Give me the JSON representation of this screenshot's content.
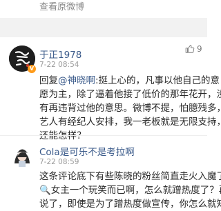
{
  "top": {
    "view_original": "查看原微博"
  },
  "comments": [
    {
      "name": "于正1978",
      "time": "7-22 08:54",
      "likes": "9",
      "avatar_text": "于正",
      "reply_prefix": "回复",
      "mention": "@神晓啊",
      "lines": [
        ":挺上心的，凡事以他自己的意",
        "愿为主，除了逼着他接了低价的那年花开，没",
        "有再违背过他的意思。微博不提，怕臆残多，",
        "艺人有经纪人安排，我一老板就是无限支持，",
        "还能怎样？"
      ]
    },
    {
      "name": "Cola是可乐不是考拉啊",
      "time": "7-22 08:59",
      "lines": [
        "这条评论底下有些陈晓的粉丝简直走火入魔了",
        "🔍女主一个玩笑而已啊，怎么就蹭热度了？再",
        "说了，即使是为了蹭热度做宣传，你怎么就知"
      ]
    }
  ],
  "colors": {
    "link": "#3a5a8a",
    "badge": "#ff9b1a"
  },
  "icons": [
    "thumbs-up-icon",
    "vip-badge-icon",
    "search-emoji-icon"
  ]
}
